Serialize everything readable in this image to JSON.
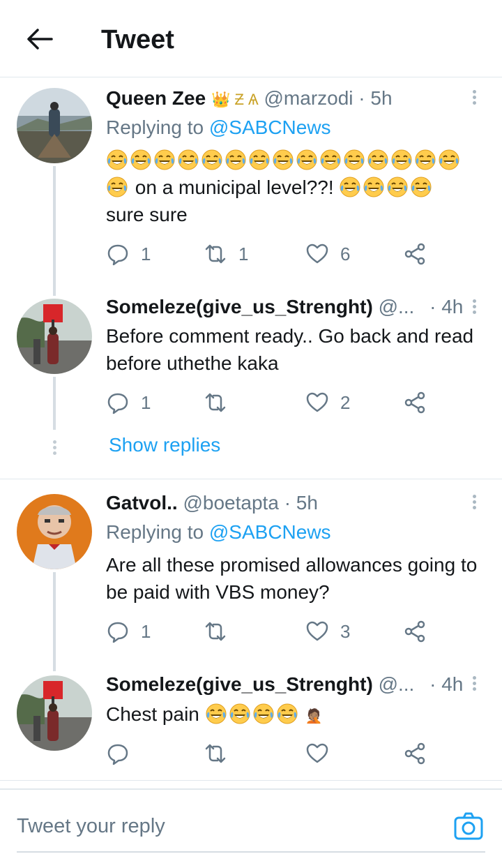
{
  "header": {
    "title": "Tweet",
    "back_icon": "back-arrow-icon"
  },
  "tweets": [
    {
      "name": "Queen Zee",
      "name_badges": "👑 Ƶ Ѧ",
      "handle": "@marzodi",
      "time": "· 5h",
      "replying_prefix": "Replying to",
      "replying_to": "@SABCNews",
      "body_text_1": "on a municipal level??!",
      "body_text_2": "sure sure",
      "replies": "1",
      "retweets": "1",
      "likes": "6"
    },
    {
      "name": "Someleze(give_us_Strenght)",
      "handle": "@...",
      "time": "· 4h",
      "body": "Before comment ready.. Go back and read before uthethe kaka",
      "replies": "1",
      "retweets": "",
      "likes": "2",
      "show_replies": "Show replies"
    },
    {
      "name": "Gatvol..",
      "handle": "@boetapta",
      "time": "· 5h",
      "replying_prefix": "Replying to",
      "replying_to": "@SABCNews",
      "body": "Are all these promised allowances going to be paid with VBS money?",
      "replies": "1",
      "retweets": "",
      "likes": "3"
    },
    {
      "name": "Someleze(give_us_Strenght)",
      "handle": "@...",
      "time": "· 4h",
      "body": "Chest pain",
      "body_tail": "🤦🏽",
      "replies": "",
      "retweets": "",
      "likes": ""
    }
  ],
  "compose": {
    "placeholder": "Tweet your reply",
    "camera_icon": "camera-icon"
  },
  "colors": {
    "accent": "#1da1f2",
    "muted": "#657786",
    "divider": "#e1e8ed"
  }
}
